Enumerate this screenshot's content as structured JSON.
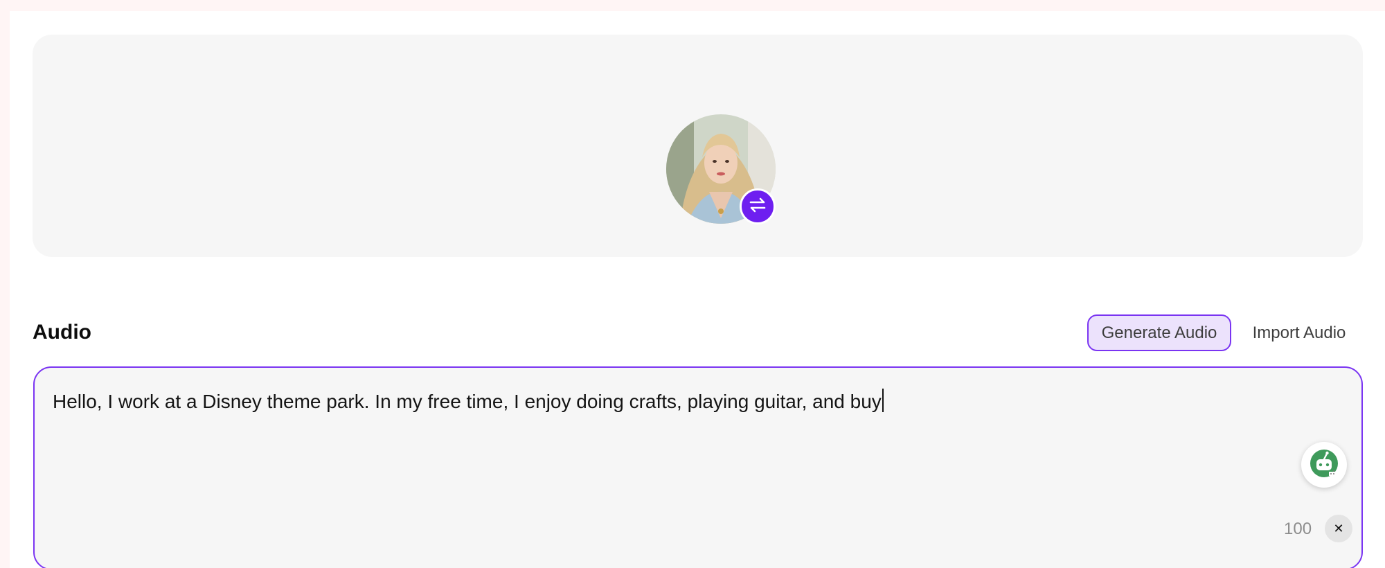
{
  "avatar": {
    "alt": "Woman with long blonde hair in a light blue dress",
    "swap_icon": "swap-arrows-icon"
  },
  "audio": {
    "section_title": "Audio",
    "generate_label": "Generate Audio",
    "import_label": "Import Audio",
    "text_value": "Hello, I work at a Disney theme park. In my free time, I enjoy doing crafts, playing guitar, and buy",
    "char_count": "100",
    "clear_icon": "close-icon",
    "assistant_icon": "robot-assistant-icon"
  },
  "colors": {
    "accent": "#6e1ff0",
    "accent_border": "#7a34f2",
    "accent_soft": "#ece2fc",
    "card_bg": "#f6f6f6"
  }
}
